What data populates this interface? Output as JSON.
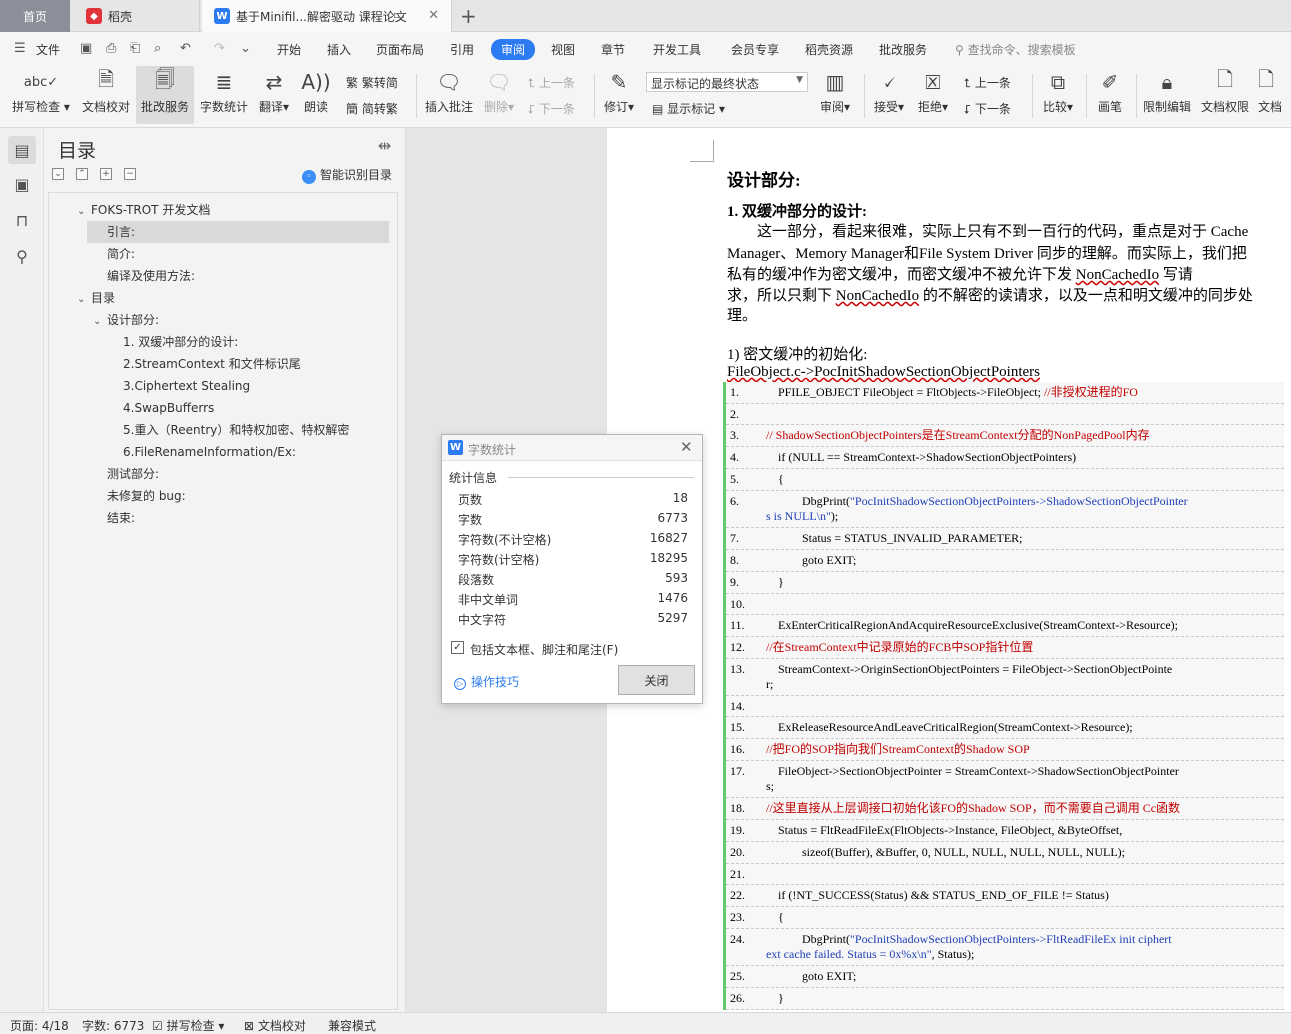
{
  "tabs": {
    "home": "首页",
    "t1": "稻壳",
    "t2": "基于Minifil...解密驱动 课程论文"
  },
  "menu": {
    "file": "文件",
    "items": [
      "开始",
      "插入",
      "页面布局",
      "引用",
      "审阅",
      "视图",
      "章节",
      "开发工具",
      "会员专享",
      "稻壳资源",
      "批改服务"
    ],
    "active": "审阅",
    "search": "查找命令、搜索模板"
  },
  "ribbon": {
    "spell": "拼写检查",
    "proof": "文档校对",
    "correct": "批改服务",
    "wordcount": "字数统计",
    "translate": "翻译",
    "read": "朗读",
    "trad": "繁转简",
    "simp": "简转繁",
    "insert_comment": "插入批注",
    "delete": "删除",
    "prev": "上一条",
    "next": "下一条",
    "revise": "修订",
    "markup_mode": "显示标记的最终状态",
    "show_markup": "显示标记",
    "review": "审阅",
    "accept": "接受",
    "reject": "拒绝",
    "prev2": "上一条",
    "next2": "下一条",
    "compare": "比较",
    "pen": "画笔",
    "restrict": "限制编辑",
    "perm": "文档权限",
    "more": "文档"
  },
  "toc": {
    "title": "目录",
    "smart": "智能识别目录",
    "items": [
      {
        "label": "FOKS-TROT 开发文档",
        "arrow": "⌄"
      },
      {
        "label": "引言:"
      },
      {
        "label": "简介:"
      },
      {
        "label": "编译及使用方法:"
      },
      {
        "label": "目录",
        "arrow": "⌄"
      },
      {
        "label": "设计部分:",
        "arrow": "⌄"
      },
      {
        "label": "1. 双缓冲部分的设计:"
      },
      {
        "label": "2.StreamContext 和文件标识尾"
      },
      {
        "label": "3.Ciphertext Stealing"
      },
      {
        "label": "4.SwapBufferrs"
      },
      {
        "label": "5.重入（Reentry）和特权加密、特权解密"
      },
      {
        "label": "6.FileRenameInformation/Ex:"
      },
      {
        "label": "测试部分:"
      },
      {
        "label": "未修复的 bug:"
      },
      {
        "label": "结束:"
      }
    ]
  },
  "doc": {
    "h1": "设计部分:",
    "h2": "1. 双缓冲部分的设计:",
    "p1": "这一部分，看起来很难，实际上只有不到一百行的代码，重点是对于 Cache",
    "p2": "Manager、Memory Manager和File System Driver 同步的理解。而实际上，我们把",
    "p3a": "私有的缓冲作为密文缓冲，而密文缓冲不被允许下发 ",
    "p3b": "NonCachedIo",
    "p3c": " 写请",
    "p4a": "求，所以只剩下 ",
    "p4b": "NonCachedIo",
    "p4c": " 的不解密的读请求，以及一点和明文缓冲的同步处",
    "p5": "理。",
    "s1": "1)   密文缓冲的初始化:",
    "s2": "FileObject.c->PocInitShadowSectionObjectPointers",
    "code": [
      {
        "n": "1.",
        "t": "        PFILE_OBJECT FileObject = FltObjects->FileObject; ",
        "c": "//非授权进程的FO"
      },
      {
        "n": "2.",
        "t": ""
      },
      {
        "n": "3.",
        "t": "    ",
        "c": "// ShadowSectionObjectPointers是在StreamContext分配的NonPagedPool内存"
      },
      {
        "n": "4.",
        "t": "        if (NULL == StreamContext->ShadowSectionObjectPointers)"
      },
      {
        "n": "5.",
        "t": "        {"
      },
      {
        "n": "6.",
        "t": "                DbgPrint(",
        "s": "\"PocInitShadowSectionObjectPointers->ShadowSectionObjectPointer",
        "t2": "\n    ",
        "s2": "s is NULL\\n\"",
        "t3": ");"
      },
      {
        "n": "7.",
        "t": "                Status = STATUS_INVALID_PARAMETER;"
      },
      {
        "n": "8.",
        "t": "                goto EXIT;"
      },
      {
        "n": "9.",
        "t": "        }"
      },
      {
        "n": "10.",
        "t": ""
      },
      {
        "n": "11.",
        "t": "        ExEnterCriticalRegionAndAcquireResourceExclusive(StreamContext->Resource);"
      },
      {
        "n": "12.",
        "t": "    ",
        "c": "//在StreamContext中记录原始的FCB中SOP指针位置"
      },
      {
        "n": "13.",
        "t": "        StreamContext->OriginSectionObjectPointers = FileObject->SectionObjectPointe\n    r;"
      },
      {
        "n": "14.",
        "t": ""
      },
      {
        "n": "15.",
        "t": "        ExReleaseResourceAndLeaveCriticalRegion(StreamContext->Resource);"
      },
      {
        "n": "16.",
        "t": "    ",
        "c": "//把FO的SOP指向我们StreamContext的Shadow SOP"
      },
      {
        "n": "17.",
        "t": "        FileObject->SectionObjectPointer = StreamContext->ShadowSectionObjectPointer\n    s;"
      },
      {
        "n": "18.",
        "t": "    ",
        "c": "//这里直接从上层调接口初始化该FO的Shadow SOP，而不需要自己调用 Cc函数"
      },
      {
        "n": "19.",
        "t": "        Status = FltReadFileEx(FltObjects->Instance, FileObject, &ByteOffset,"
      },
      {
        "n": "20.",
        "t": "                sizeof(Buffer), &Buffer, 0, NULL, NULL, NULL, NULL, NULL);"
      },
      {
        "n": "21.",
        "t": ""
      },
      {
        "n": "22.",
        "t": "        if (!NT_SUCCESS(Status) && STATUS_END_OF_FILE != Status)"
      },
      {
        "n": "23.",
        "t": "        {"
      },
      {
        "n": "24.",
        "t": "                DbgPrint(",
        "s": "\"PocInitShadowSectionObjectPointers->FltReadFileEx init ciphert",
        "t2": "\n    ",
        "s2": "ext cache failed. Status = 0x%x\\n\"",
        "t3": ", Status);"
      },
      {
        "n": "25.",
        "t": "                goto EXIT;"
      },
      {
        "n": "26.",
        "t": "        }"
      }
    ]
  },
  "dialog": {
    "title": "字数统计",
    "section": "统计信息",
    "rows": [
      {
        "k": "页数",
        "v": "18"
      },
      {
        "k": "字数",
        "v": "6773"
      },
      {
        "k": "字符数(不计空格)",
        "v": "16827"
      },
      {
        "k": "字符数(计空格)",
        "v": "18295"
      },
      {
        "k": "段落数",
        "v": "593"
      },
      {
        "k": "非中文单词",
        "v": "1476"
      },
      {
        "k": "中文字符",
        "v": "5297"
      }
    ],
    "include": "包括文本框、脚注和尾注(F)",
    "include_checked": true,
    "tips": "操作技巧",
    "close": "关闭"
  },
  "status": {
    "page": "页面: 4/18",
    "words": "字数: 6773",
    "spell": "拼写检查",
    "proof": "文档校对",
    "compat": "兼容模式"
  },
  "colors": {
    "accent": "#2d7bf0",
    "comment": "#c00000",
    "string": "#1f3fb8",
    "revision_bar": "#63c96a"
  }
}
